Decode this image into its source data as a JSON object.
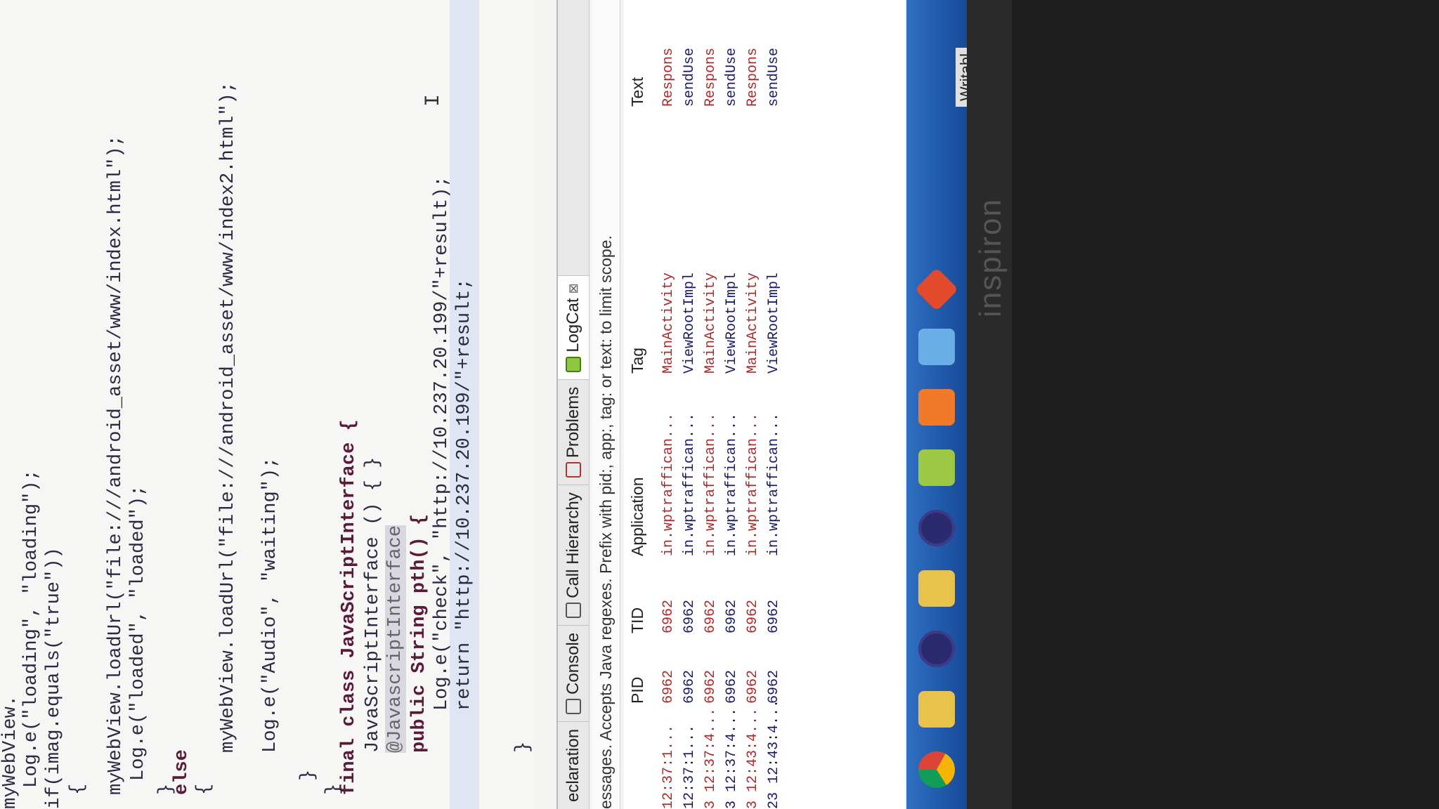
{
  "editor": {
    "lines": [
      "myWebView.",
      "Log.e(\"loading\", \"loading\");",
      "if(imag.equals(\"true\"))",
      "{",
      "myWebView.loadUrl(\"file:///android_asset/www/index.html\");",
      "Log.e(\"loaded\", \"loaded\");",
      "}",
      "else",
      "{",
      "myWebView.loadUrl(\"file:///android_asset/www/index2.html\");",
      "Log.e(\"Audio\", \"waiting\");",
      "}",
      "}",
      "final class JavaScriptInterface {",
      "JavaScriptInterface () { }",
      "@JavascriptInterface",
      "public String pth() {",
      "Log.e(\"check\", \"http://10.237.20.199/\"+result);",
      "return \"http://10.237.20.199/\"+result;",
      "}"
    ]
  },
  "tabs": [
    {
      "label": "eclaration"
    },
    {
      "label": "Console"
    },
    {
      "label": "Call Hierarchy"
    },
    {
      "label": "Problems"
    },
    {
      "label": "LogCat",
      "close": "⊠"
    }
  ],
  "filter_hint": "essages. Accepts Java regexes. Prefix with pid:, app:, tag: or text: to limit scope.",
  "logcat": {
    "columns": [
      "PID",
      "TID",
      "Application",
      "Tag",
      "Text"
    ],
    "rows": [
      {
        "time": "12:37:1...",
        "pid": "6962",
        "tid": "6962",
        "app": "in.wptraffican...",
        "tag": "MainActivity",
        "text": "Respons",
        "level": "err"
      },
      {
        "time": "12:37:1...",
        "pid": "6962",
        "tid": "6962",
        "app": "in.wptraffican...",
        "tag": "ViewRootImpl",
        "text": "sendUse",
        "level": "dbg"
      },
      {
        "time": "3 12:37:4...",
        "pid": "6962",
        "tid": "6962",
        "app": "in.wptraffican...",
        "tag": "MainActivity",
        "text": "Respons",
        "level": "err"
      },
      {
        "time": "3 12:37:4...",
        "pid": "6962",
        "tid": "6962",
        "app": "in.wptraffican...",
        "tag": "ViewRootImpl",
        "text": "sendUse",
        "level": "dbg"
      },
      {
        "time": "3 12:43:4...",
        "pid": "6962",
        "tid": "6962",
        "app": "in.wptraffican...",
        "tag": "MainActivity",
        "text": "Respons",
        "level": "err"
      },
      {
        "time": "23 12:43:4...",
        "pid": "6962",
        "tid": "6962",
        "app": "in.wptraffican...",
        "tag": "ViewRootImpl",
        "text": "sendUse",
        "level": "dbg"
      }
    ]
  },
  "taskbar": {
    "icons": [
      "chrome-icon",
      "folder-icon",
      "eclipse-icon",
      "sticky-notes-icon",
      "eclipse-icon",
      "android-icon",
      "xampp-icon",
      "app-icon",
      "git-icon"
    ]
  },
  "status": "Writabl",
  "brand": "inspiron"
}
